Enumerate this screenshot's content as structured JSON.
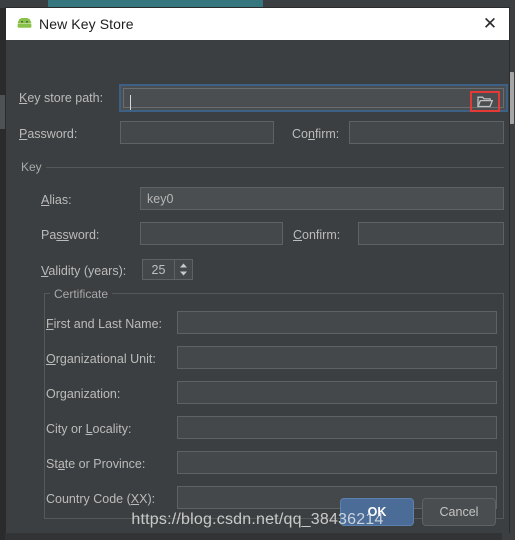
{
  "window": {
    "title": "New Key Store",
    "app_icon": "android-robot-icon",
    "close_label": "✕"
  },
  "keystore": {
    "path_label": "Key store path:",
    "path_label_mnemonic": "K",
    "path_value": "",
    "browse_icon": "folder-open-icon",
    "password_label": "Password:",
    "password_label_mnemonic": "P",
    "password_value": "",
    "confirm_label": "Confirm:",
    "confirm_label_mnemonic": "n",
    "confirm_value": ""
  },
  "key_group": {
    "legend": "Key",
    "alias_label": "Alias:",
    "alias_label_mnemonic": "A",
    "alias_value": "key0",
    "password_label": "Password:",
    "password_label_mnemonic": "ss",
    "password_value": "",
    "confirm_label": "Confirm:",
    "confirm_label_mnemonic": "C",
    "confirm_value": "",
    "validity_label": "Validity (years):",
    "validity_label_mnemonic": "V",
    "validity_value": "25"
  },
  "certificate_group": {
    "legend": "Certificate",
    "fields": [
      {
        "label": "First and Last Name:",
        "mnemonic": "F",
        "value": ""
      },
      {
        "label": "Organizational Unit:",
        "mnemonic": "O",
        "value": ""
      },
      {
        "label": "Organization:",
        "mnemonic": "g",
        "value": ""
      },
      {
        "label": "City or Locality:",
        "mnemonic": "L",
        "value": ""
      },
      {
        "label": "State or Province:",
        "mnemonic": "a",
        "value": ""
      },
      {
        "label": "Country Code (XX):",
        "mnemonic": "X",
        "value": ""
      }
    ]
  },
  "footer": {
    "ok_label": "OK",
    "cancel_label": "Cancel"
  },
  "watermark": {
    "text": "https://blog.csdn.net/qq_38436214"
  },
  "colors": {
    "dialog_bg": "#3c3f41",
    "titlebar_bg": "#ffffff",
    "field_bg": "#45484a",
    "field_border": "#5e6264",
    "focus_ring": "#3d6185",
    "highlight_red": "#e53935",
    "ok_button": "#4a6c96",
    "tab_accent": "#36767f",
    "android_green": "#8ac249"
  }
}
